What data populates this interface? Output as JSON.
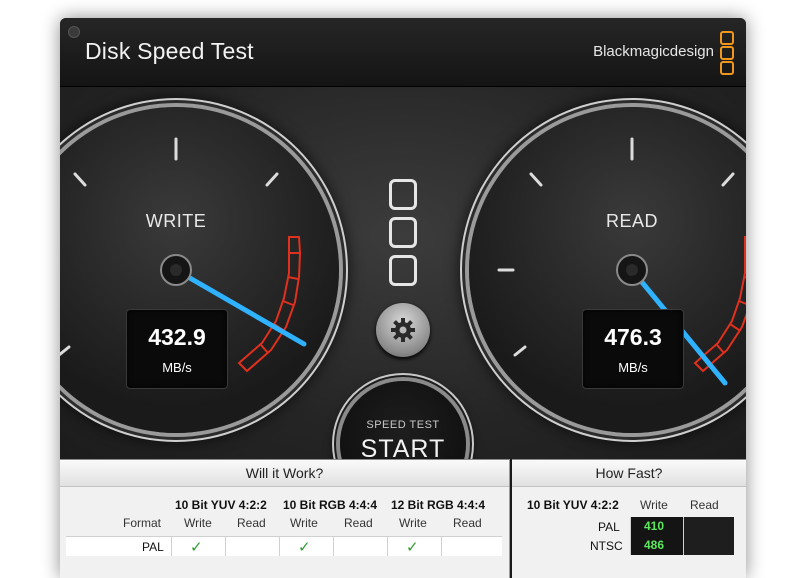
{
  "window": {
    "title": "Disk Speed Test",
    "brand": "Blackmagicdesign"
  },
  "gauges": {
    "write": {
      "label": "WRITE",
      "value": "432.9",
      "unit": "MB/s"
    },
    "read": {
      "label": "READ",
      "value": "476.3",
      "unit": "MB/s"
    }
  },
  "controls": {
    "start_small": "SPEED TEST",
    "start_big": "START"
  },
  "will_it_work": {
    "title": "Will it Work?",
    "format_header": "Format",
    "formats": [
      "10 Bit YUV 4:2:2",
      "10 Bit RGB 4:4:4",
      "12 Bit RGB 4:4:4"
    ],
    "write_label": "Write",
    "read_label": "Read",
    "rows": [
      {
        "label": "PAL",
        "checks": [
          "✓",
          "",
          "✓",
          "",
          "✓",
          ""
        ]
      }
    ]
  },
  "how_fast": {
    "title": "How Fast?",
    "format": "10 Bit YUV 4:2:2",
    "write_label": "Write",
    "read_label": "Read",
    "rows": [
      {
        "label": "PAL",
        "write": "410",
        "read": ""
      },
      {
        "label": "NTSC",
        "write": "486",
        "read": ""
      }
    ]
  },
  "colors": {
    "accent": "#2fb2ff",
    "redline": "#e0301e",
    "brand_orange": "#f0961e",
    "ok_green": "#5ce75c"
  }
}
